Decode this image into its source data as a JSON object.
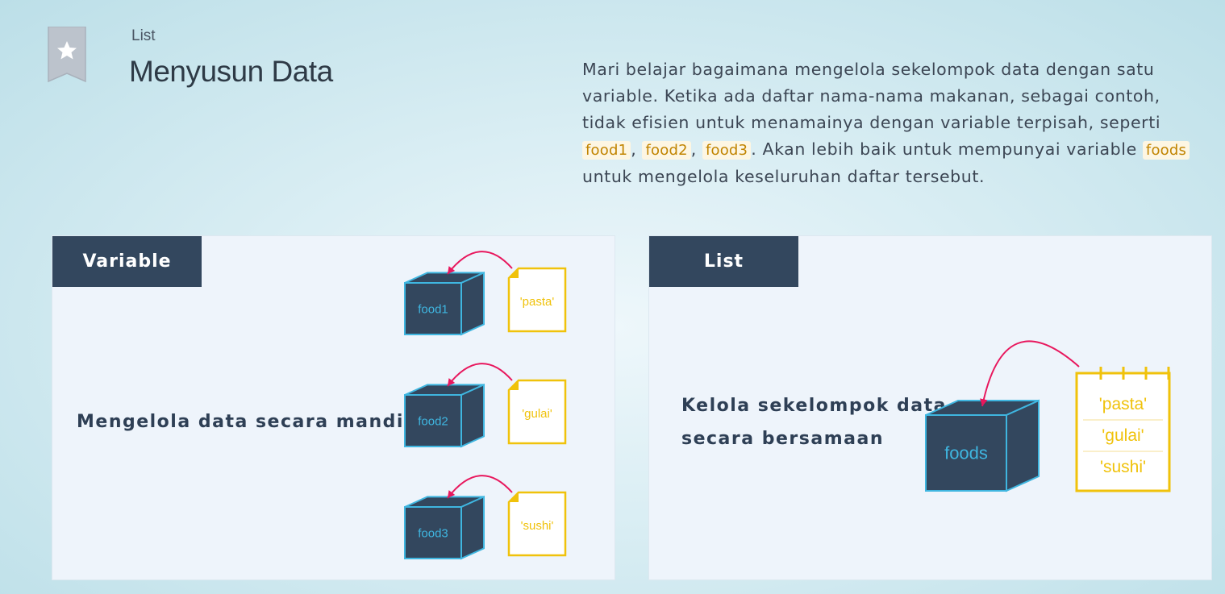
{
  "header": {
    "kicker": "List",
    "title": "Menyusun Data"
  },
  "description": {
    "part1": "Mari belajar bagaimana mengelola sekelompok data dengan satu variable. Ketika ada daftar nama-nama makanan, sebagai contoh, tidak efisien untuk menamainya dengan variable terpisah, seperti ",
    "code1": "food1",
    "sep1": ", ",
    "code2": "food2",
    "sep2": ", ",
    "code3": "food3",
    "part2": ". Akan lebih baik untuk mempunyai variable ",
    "code4": "foods",
    "part3": " untuk mengelola keseluruhan daftar tersebut."
  },
  "variable_panel": {
    "tab_label": "Variable",
    "caption": "Mengelola data secara mandiri",
    "rows": [
      {
        "box_label": "food1",
        "value": "'pasta'"
      },
      {
        "box_label": "food2",
        "value": "'gulai'"
      },
      {
        "box_label": "food3",
        "value": "'sushi'"
      }
    ]
  },
  "list_panel": {
    "tab_label": "List",
    "caption_line1": "Kelola sekelompok data",
    "caption_line2": "secara bersamaan",
    "box_label": "foods",
    "values": [
      "'pasta'",
      "'gulai'",
      "'sushi'"
    ]
  },
  "colors": {
    "navy": "#33475e",
    "cyan": "#3fb6e0",
    "yellow": "#f0c20b",
    "arrow": "#e8175d",
    "code_text": "#c18400"
  },
  "icons": {
    "bookmark": "bookmark-star-icon"
  }
}
